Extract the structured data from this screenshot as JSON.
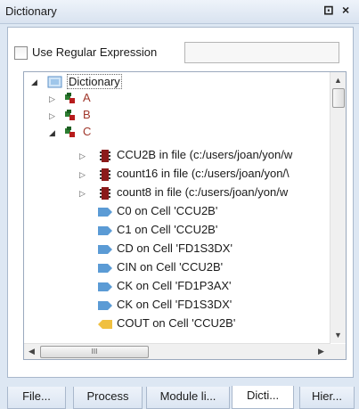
{
  "window": {
    "title": "Dictionary",
    "controls": {
      "float": "⊡",
      "close": "×"
    }
  },
  "regex": {
    "label": "Use Regular Expression",
    "checked": false,
    "value": ""
  },
  "tree": {
    "root": "Dictionary",
    "groups": [
      "A",
      "B",
      "C"
    ],
    "c_children": [
      {
        "label": "CCU2B in file (c:/users/joan/yon/w",
        "icon": "chip-icon"
      },
      {
        "label": "count16 in file (c:/users/joan/yon/\\",
        "icon": "chip-icon"
      },
      {
        "label": "count8 in file (c:/users/joan/yon/w",
        "icon": "chip-icon"
      },
      {
        "label": "C0 on  Cell 'CCU2B'",
        "icon": "input-port-icon"
      },
      {
        "label": "C1 on  Cell 'CCU2B'",
        "icon": "input-port-icon"
      },
      {
        "label": "CD on  Cell 'FD1S3DX'",
        "icon": "input-port-icon"
      },
      {
        "label": "CIN on  Cell 'CCU2B'",
        "icon": "input-port-icon"
      },
      {
        "label": "CK on  Cell 'FD1P3AX'",
        "icon": "input-port-icon"
      },
      {
        "label": "CK on  Cell 'FD1S3DX'",
        "icon": "input-port-icon"
      },
      {
        "label": "COUT on  Cell 'CCU2B'",
        "icon": "output-port-icon"
      }
    ]
  },
  "hscroll_grip": "III",
  "tabs": [
    {
      "label": "File..."
    },
    {
      "label": "Process"
    },
    {
      "label": "Module li..."
    },
    {
      "label": "Dicti...",
      "active": true
    },
    {
      "label": "Hier..."
    }
  ],
  "colors": {
    "accent": "#4a90d9",
    "chip": "#8b1a1a",
    "group_text": "#a0372b",
    "port": "#5b9bd5",
    "output_port": "#f0c040"
  }
}
